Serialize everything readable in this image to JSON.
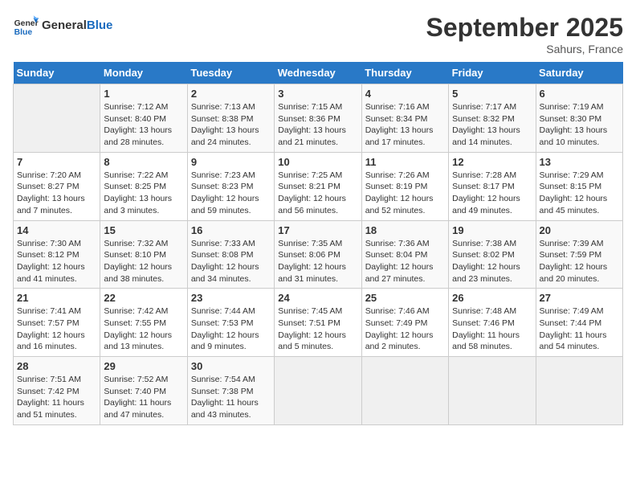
{
  "header": {
    "logo_general": "General",
    "logo_blue": "Blue",
    "month": "September 2025",
    "location": "Sahurs, France"
  },
  "days_of_week": [
    "Sunday",
    "Monday",
    "Tuesday",
    "Wednesday",
    "Thursday",
    "Friday",
    "Saturday"
  ],
  "weeks": [
    [
      {
        "day": "",
        "info": ""
      },
      {
        "day": "1",
        "info": "Sunrise: 7:12 AM\nSunset: 8:40 PM\nDaylight: 13 hours and 28 minutes."
      },
      {
        "day": "2",
        "info": "Sunrise: 7:13 AM\nSunset: 8:38 PM\nDaylight: 13 hours and 24 minutes."
      },
      {
        "day": "3",
        "info": "Sunrise: 7:15 AM\nSunset: 8:36 PM\nDaylight: 13 hours and 21 minutes."
      },
      {
        "day": "4",
        "info": "Sunrise: 7:16 AM\nSunset: 8:34 PM\nDaylight: 13 hours and 17 minutes."
      },
      {
        "day": "5",
        "info": "Sunrise: 7:17 AM\nSunset: 8:32 PM\nDaylight: 13 hours and 14 minutes."
      },
      {
        "day": "6",
        "info": "Sunrise: 7:19 AM\nSunset: 8:30 PM\nDaylight: 13 hours and 10 minutes."
      }
    ],
    [
      {
        "day": "7",
        "info": "Sunrise: 7:20 AM\nSunset: 8:27 PM\nDaylight: 13 hours and 7 minutes."
      },
      {
        "day": "8",
        "info": "Sunrise: 7:22 AM\nSunset: 8:25 PM\nDaylight: 13 hours and 3 minutes."
      },
      {
        "day": "9",
        "info": "Sunrise: 7:23 AM\nSunset: 8:23 PM\nDaylight: 12 hours and 59 minutes."
      },
      {
        "day": "10",
        "info": "Sunrise: 7:25 AM\nSunset: 8:21 PM\nDaylight: 12 hours and 56 minutes."
      },
      {
        "day": "11",
        "info": "Sunrise: 7:26 AM\nSunset: 8:19 PM\nDaylight: 12 hours and 52 minutes."
      },
      {
        "day": "12",
        "info": "Sunrise: 7:28 AM\nSunset: 8:17 PM\nDaylight: 12 hours and 49 minutes."
      },
      {
        "day": "13",
        "info": "Sunrise: 7:29 AM\nSunset: 8:15 PM\nDaylight: 12 hours and 45 minutes."
      }
    ],
    [
      {
        "day": "14",
        "info": "Sunrise: 7:30 AM\nSunset: 8:12 PM\nDaylight: 12 hours and 41 minutes."
      },
      {
        "day": "15",
        "info": "Sunrise: 7:32 AM\nSunset: 8:10 PM\nDaylight: 12 hours and 38 minutes."
      },
      {
        "day": "16",
        "info": "Sunrise: 7:33 AM\nSunset: 8:08 PM\nDaylight: 12 hours and 34 minutes."
      },
      {
        "day": "17",
        "info": "Sunrise: 7:35 AM\nSunset: 8:06 PM\nDaylight: 12 hours and 31 minutes."
      },
      {
        "day": "18",
        "info": "Sunrise: 7:36 AM\nSunset: 8:04 PM\nDaylight: 12 hours and 27 minutes."
      },
      {
        "day": "19",
        "info": "Sunrise: 7:38 AM\nSunset: 8:02 PM\nDaylight: 12 hours and 23 minutes."
      },
      {
        "day": "20",
        "info": "Sunrise: 7:39 AM\nSunset: 7:59 PM\nDaylight: 12 hours and 20 minutes."
      }
    ],
    [
      {
        "day": "21",
        "info": "Sunrise: 7:41 AM\nSunset: 7:57 PM\nDaylight: 12 hours and 16 minutes."
      },
      {
        "day": "22",
        "info": "Sunrise: 7:42 AM\nSunset: 7:55 PM\nDaylight: 12 hours and 13 minutes."
      },
      {
        "day": "23",
        "info": "Sunrise: 7:44 AM\nSunset: 7:53 PM\nDaylight: 12 hours and 9 minutes."
      },
      {
        "day": "24",
        "info": "Sunrise: 7:45 AM\nSunset: 7:51 PM\nDaylight: 12 hours and 5 minutes."
      },
      {
        "day": "25",
        "info": "Sunrise: 7:46 AM\nSunset: 7:49 PM\nDaylight: 12 hours and 2 minutes."
      },
      {
        "day": "26",
        "info": "Sunrise: 7:48 AM\nSunset: 7:46 PM\nDaylight: 11 hours and 58 minutes."
      },
      {
        "day": "27",
        "info": "Sunrise: 7:49 AM\nSunset: 7:44 PM\nDaylight: 11 hours and 54 minutes."
      }
    ],
    [
      {
        "day": "28",
        "info": "Sunrise: 7:51 AM\nSunset: 7:42 PM\nDaylight: 11 hours and 51 minutes."
      },
      {
        "day": "29",
        "info": "Sunrise: 7:52 AM\nSunset: 7:40 PM\nDaylight: 11 hours and 47 minutes."
      },
      {
        "day": "30",
        "info": "Sunrise: 7:54 AM\nSunset: 7:38 PM\nDaylight: 11 hours and 43 minutes."
      },
      {
        "day": "",
        "info": ""
      },
      {
        "day": "",
        "info": ""
      },
      {
        "day": "",
        "info": ""
      },
      {
        "day": "",
        "info": ""
      }
    ]
  ]
}
